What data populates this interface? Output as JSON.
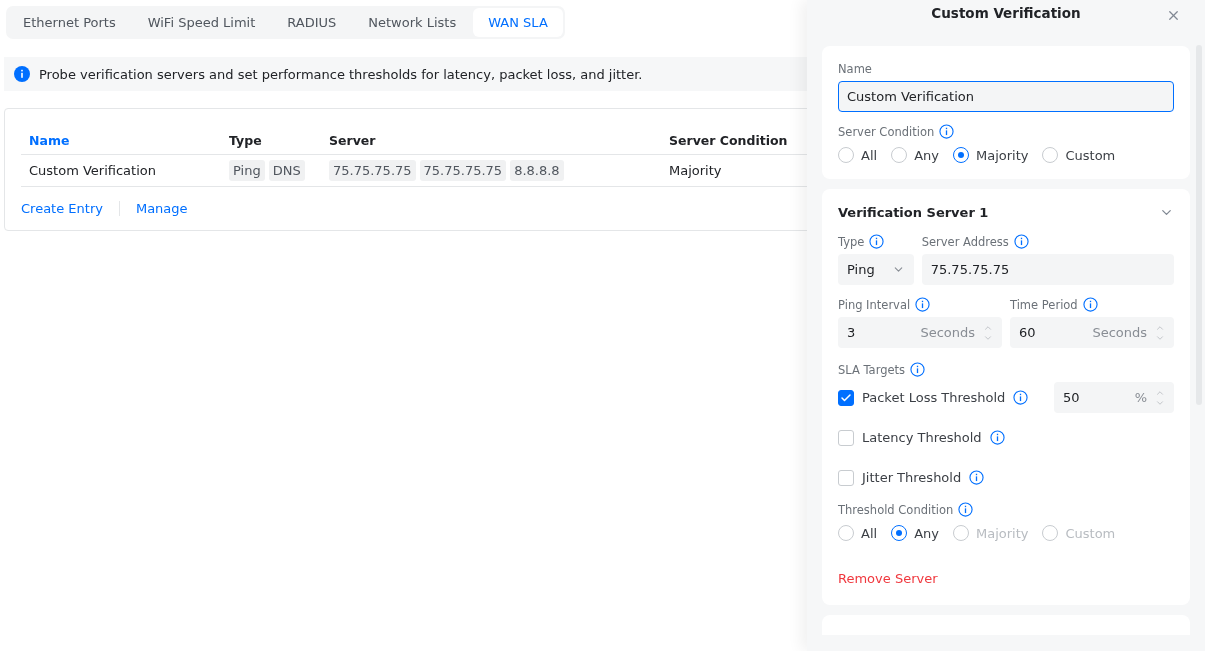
{
  "tabs": [
    {
      "label": "Ethernet Ports",
      "selected": false
    },
    {
      "label": "WiFi Speed Limit",
      "selected": false
    },
    {
      "label": "RADIUS",
      "selected": false
    },
    {
      "label": "Network Lists",
      "selected": false
    },
    {
      "label": "WAN SLA",
      "selected": true
    }
  ],
  "info_banner": "Probe verification servers and set performance thresholds for latency, packet loss, and jitter.",
  "table": {
    "columns": [
      {
        "label": "Name",
        "sortable": true
      },
      {
        "label": "Type",
        "sortable": false
      },
      {
        "label": "Server",
        "sortable": false
      },
      {
        "label": "Server Condition",
        "sortable": false
      }
    ],
    "rows": [
      {
        "name": "Custom Verification",
        "types": [
          "Ping",
          "DNS"
        ],
        "servers": [
          "75.75.75.75",
          "75.75.75.75",
          "8.8.8.8"
        ],
        "condition": "Majority"
      }
    ],
    "actions": [
      "Create Entry",
      "Manage"
    ]
  },
  "panel": {
    "title": "Custom Verification",
    "name_field": {
      "label": "Name",
      "value": "Custom Verification",
      "focused": true
    },
    "server_condition": {
      "label": "Server Condition",
      "options": [
        {
          "label": "All",
          "selected": false,
          "disabled": false
        },
        {
          "label": "Any",
          "selected": false,
          "disabled": false
        },
        {
          "label": "Majority",
          "selected": true,
          "disabled": false
        },
        {
          "label": "Custom",
          "selected": false,
          "disabled": false
        }
      ]
    },
    "server": {
      "title": "Verification Server 1",
      "expanded": true,
      "type": {
        "label": "Type",
        "value": "Ping"
      },
      "address": {
        "label": "Server Address",
        "value": "75.75.75.75"
      },
      "ping_interval": {
        "label": "Ping Interval",
        "value": "3",
        "unit": "Seconds"
      },
      "time_period": {
        "label": "Time Period",
        "value": "60",
        "unit": "Seconds"
      },
      "sla_targets": {
        "label": "SLA Targets",
        "items": [
          {
            "label": "Packet Loss Threshold",
            "checked": true,
            "value": "50",
            "unit": "%"
          },
          {
            "label": "Latency Threshold",
            "checked": false
          },
          {
            "label": "Jitter Threshold",
            "checked": false
          }
        ]
      },
      "threshold_condition": {
        "label": "Threshold Condition",
        "options": [
          {
            "label": "All",
            "selected": false,
            "disabled": false
          },
          {
            "label": "Any",
            "selected": true,
            "disabled": false
          },
          {
            "label": "Majority",
            "selected": false,
            "disabled": true
          },
          {
            "label": "Custom",
            "selected": false,
            "disabled": true
          }
        ]
      },
      "remove": "Remove Server"
    }
  }
}
